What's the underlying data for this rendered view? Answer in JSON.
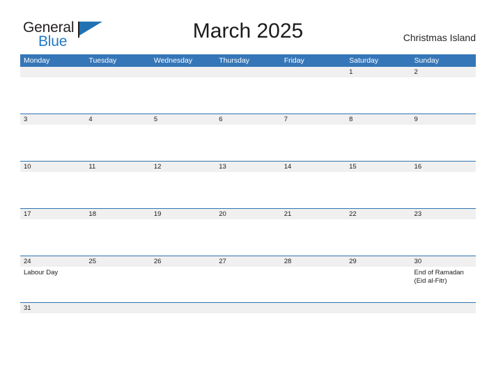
{
  "logo": {
    "word_one": "General",
    "word_two": "Blue",
    "flag_icon": "blue-triangle-flag-icon",
    "brand_blue": "#1f7ac4",
    "brand_dark": "#231f20"
  },
  "header": {
    "title": "March 2025",
    "location": "Christmas Island"
  },
  "calendar": {
    "header_bg": "#3576b8",
    "band_bg": "#f0f0f0",
    "rule_color": "#2e73b0",
    "day_names": [
      "Monday",
      "Tuesday",
      "Wednesday",
      "Thursday",
      "Friday",
      "Saturday",
      "Sunday"
    ],
    "weeks": [
      {
        "days": [
          {
            "num": "",
            "events": []
          },
          {
            "num": "",
            "events": []
          },
          {
            "num": "",
            "events": []
          },
          {
            "num": "",
            "events": []
          },
          {
            "num": "",
            "events": []
          },
          {
            "num": "1",
            "events": []
          },
          {
            "num": "2",
            "events": []
          }
        ]
      },
      {
        "days": [
          {
            "num": "3",
            "events": []
          },
          {
            "num": "4",
            "events": []
          },
          {
            "num": "5",
            "events": []
          },
          {
            "num": "6",
            "events": []
          },
          {
            "num": "7",
            "events": []
          },
          {
            "num": "8",
            "events": []
          },
          {
            "num": "9",
            "events": []
          }
        ]
      },
      {
        "days": [
          {
            "num": "10",
            "events": []
          },
          {
            "num": "11",
            "events": []
          },
          {
            "num": "12",
            "events": []
          },
          {
            "num": "13",
            "events": []
          },
          {
            "num": "14",
            "events": []
          },
          {
            "num": "15",
            "events": []
          },
          {
            "num": "16",
            "events": []
          }
        ]
      },
      {
        "days": [
          {
            "num": "17",
            "events": []
          },
          {
            "num": "18",
            "events": []
          },
          {
            "num": "19",
            "events": []
          },
          {
            "num": "20",
            "events": []
          },
          {
            "num": "21",
            "events": []
          },
          {
            "num": "22",
            "events": []
          },
          {
            "num": "23",
            "events": []
          }
        ]
      },
      {
        "days": [
          {
            "num": "24",
            "events": [
              "Labour Day"
            ]
          },
          {
            "num": "25",
            "events": []
          },
          {
            "num": "26",
            "events": []
          },
          {
            "num": "27",
            "events": []
          },
          {
            "num": "28",
            "events": []
          },
          {
            "num": "29",
            "events": []
          },
          {
            "num": "30",
            "events": [
              "End of Ramadan",
              "(Eid al-Fitr)"
            ]
          }
        ]
      },
      {
        "days": [
          {
            "num": "31",
            "events": []
          },
          {
            "num": "",
            "events": []
          },
          {
            "num": "",
            "events": []
          },
          {
            "num": "",
            "events": []
          },
          {
            "num": "",
            "events": []
          },
          {
            "num": "",
            "events": []
          },
          {
            "num": "",
            "events": []
          }
        ]
      }
    ]
  }
}
